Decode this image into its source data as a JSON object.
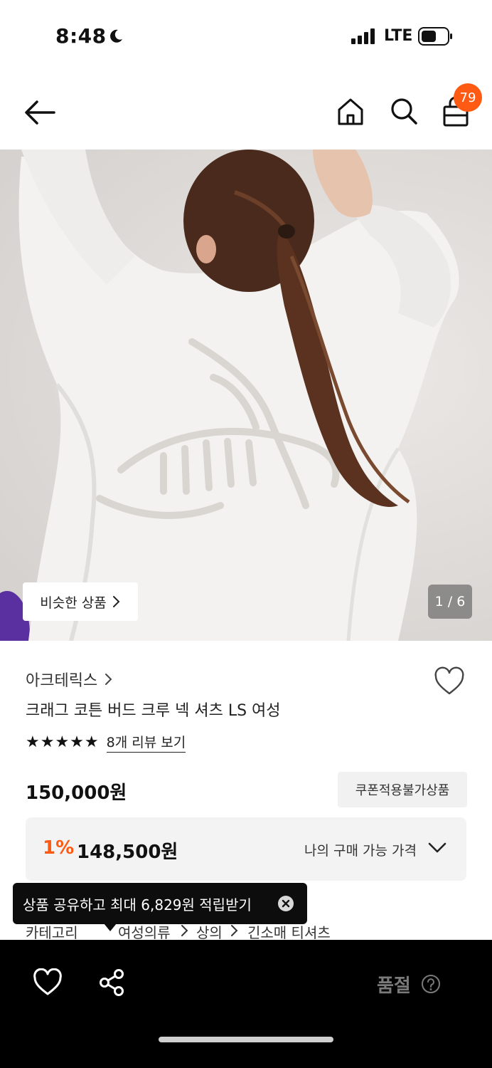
{
  "status_bar": {
    "time": "8:48",
    "network": "LTE"
  },
  "header": {
    "cart_count": "79"
  },
  "gallery": {
    "similar_label": "비슷한 상품",
    "counter": "1 / 6"
  },
  "product": {
    "brand": "아크테릭스",
    "name": "크래그 코튼 버드 크루 넥 셔츠 LS 여성",
    "rating_stars": "★★★★★",
    "review_link": "8개 리뷰 보기",
    "price": "150,000원",
    "coupon_badge": "쿠폰적용불가상품",
    "discount_rate": "1%",
    "discount_price": "148,500원",
    "my_price_label": "나의 구매 가능 가격"
  },
  "tooltip": {
    "text": "상품 공유하고 최대 6,829원 적립받기"
  },
  "category": {
    "label": "카테고리",
    "path": [
      "여성의류",
      "상의",
      "긴소매 티셔츠"
    ]
  },
  "bottom_bar": {
    "soldout_label": "품절"
  },
  "colors": {
    "accent": "#ff5a14",
    "bottom_bar": "#000000"
  }
}
